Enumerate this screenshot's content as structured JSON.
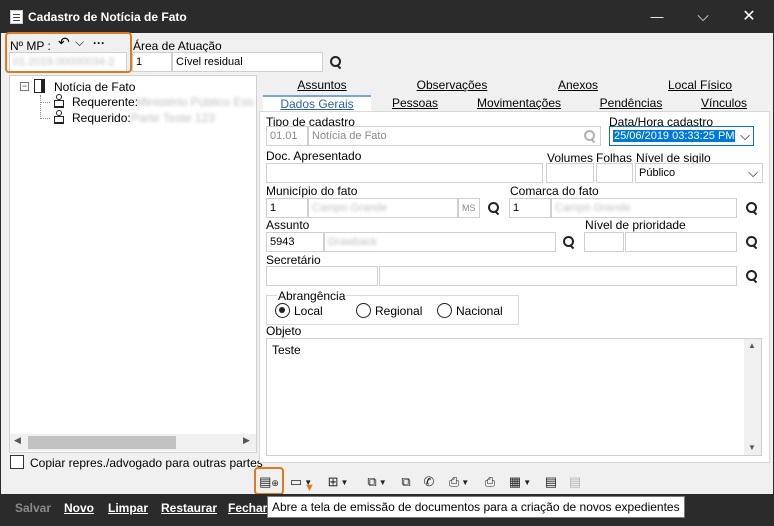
{
  "window": {
    "title": "Cadastro de Notícia de Fato",
    "minimize": "—",
    "maximize": "⌵",
    "close": "✕"
  },
  "header": {
    "mp_label": "Nº MP :",
    "mp_value": "01.2019.00000034-2",
    "area_label": "Área de Atuação",
    "area_code": "1",
    "area_value": "Cível residual",
    "undo_icon": "↶",
    "dropdown_icon": "⌵",
    "more_icon": "···"
  },
  "tree": {
    "root_label": "Notícia de Fato",
    "items": [
      {
        "label": "Requerente:",
        "value": "Ministério Público Estadual"
      },
      {
        "label": "Requerido:",
        "value": "Parte Teste 123"
      }
    ],
    "copy_checkbox_label": "Copiar repres./advogado para outras partes"
  },
  "tabs": {
    "row1": [
      "Assuntos",
      "Observações",
      "Anexos",
      "Local Físico"
    ],
    "row2": [
      "Dados Gerais",
      "Pessoas",
      "Movimentações",
      "Pendências",
      "Vínculos"
    ]
  },
  "form": {
    "tipo_label": "Tipo de cadastro",
    "tipo_code": "01.01",
    "tipo_value": "Notícia de Fato",
    "data_label": "Data/Hora cadastro",
    "data_value": "25/06/2019 03:33:25 PM",
    "doc_label": "Doc. Apresentado",
    "volumes_label": "Volumes",
    "folhas_label": "Folhas",
    "sigilo_label": "Nível de sigilo",
    "sigilo_value": "Público",
    "municipio_label": "Município do fato",
    "municipio_code": "1",
    "municipio_value": "Campo Grande",
    "municipio_uf": "MS",
    "comarca_label": "Comarca do fato",
    "comarca_code": "1",
    "comarca_value": "Campo Grande",
    "assunto_label": "Assunto",
    "assunto_code": "5943",
    "assunto_value": "Drawback",
    "prioridade_label": "Nível de prioridade",
    "secretario_label": "Secretário",
    "abrangencia_label": "Abrangência",
    "abrangencia_options": [
      "Local",
      "Regional",
      "Nacional"
    ],
    "objeto_label": "Objeto",
    "objeto_value": "Teste"
  },
  "toolbar": {
    "tooltip": "Abre a tela de emissão de documentos para a criação de novos expedientes"
  },
  "bottom": {
    "salvar": "Salvar",
    "novo": "Novo",
    "limpar": "Limpar",
    "restaurar": "Restaurar",
    "fechar": "Fechar"
  },
  "colors": {
    "highlight": "#e07a1f",
    "titlebar": "#2b2b2b",
    "selection": "#0078d7"
  }
}
